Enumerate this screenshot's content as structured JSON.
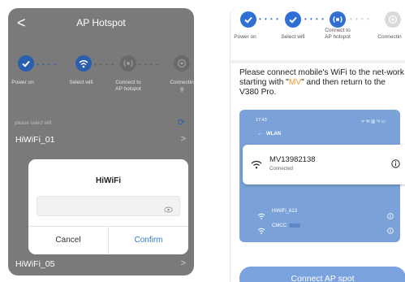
{
  "left_screen": {
    "back_glyph": "<",
    "title": "AP Hotspot",
    "steps": [
      {
        "label": "Power on",
        "icon": "check-icon"
      },
      {
        "label": "Select wifi",
        "icon": "wifi-icon"
      },
      {
        "label": "Connect to AP hotspot",
        "icon": "hotspot-icon"
      },
      {
        "label": "Connectin g",
        "icon": "camera-icon"
      }
    ],
    "list_hint": "please select wifi",
    "wifi_list": [
      "HiWiFi_01",
      "HiWiFi_05"
    ],
    "dialog": {
      "title": "HiWiFi",
      "password_placeholder": "",
      "cancel_label": "Cancel",
      "confirm_label": "Confirm"
    }
  },
  "right_screen": {
    "steps": [
      {
        "label": "Power on",
        "icon": "check-icon"
      },
      {
        "label": "Select wifi",
        "icon": "check-icon"
      },
      {
        "label": "Connect to AP hotspot",
        "icon": "hotspot-icon"
      },
      {
        "label": "Connectin",
        "icon": "camera-icon"
      }
    ],
    "instruction_before": "Please connect mobile's WiFi to the net-work starting with \"",
    "instruction_highlight": "MV",
    "instruction_after": "\" and then return to the V380 Pro.",
    "screenshot": {
      "time": "17:43",
      "status_icons": "ᯤ ✉ ▥ ⁵ᵍ ▭",
      "back_arrow": "←",
      "header": "WLAN",
      "connected_network": {
        "name": "MV13982138",
        "status": "Connected"
      },
      "other_networks": [
        "HiWiFi_613",
        "CMCC"
      ]
    },
    "connect_button": "Connect AP spot"
  },
  "colors": {
    "accent_blue": "#2f6fd6",
    "light_blue": "#7aa2de",
    "highlight_orange": "#f39a2b",
    "overlay_gray": "#7a7a7a"
  }
}
